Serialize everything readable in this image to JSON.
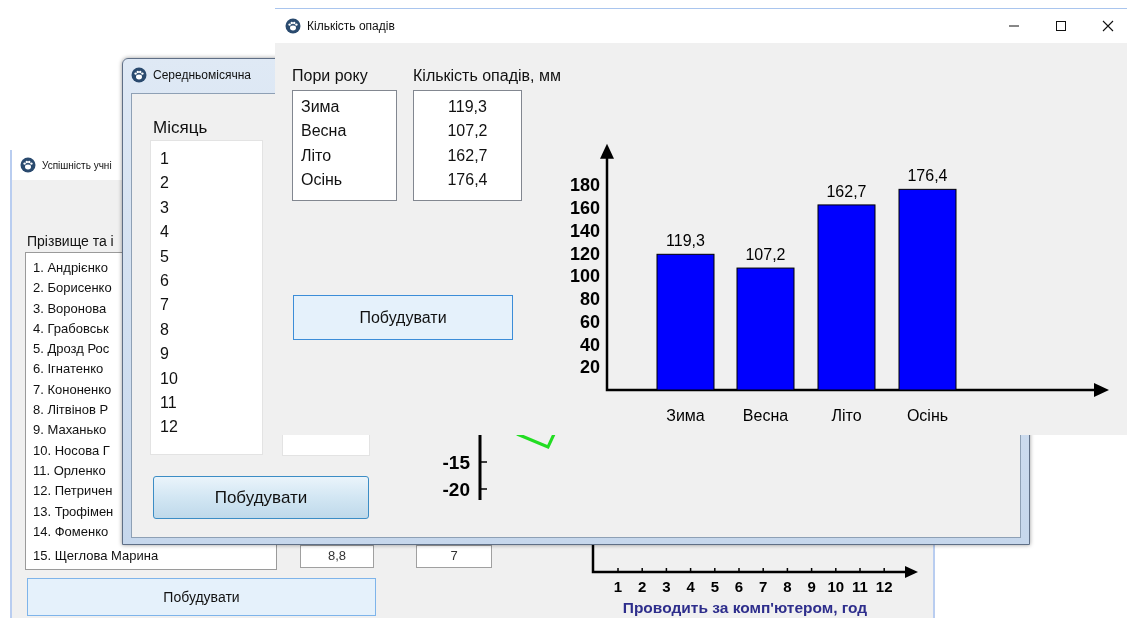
{
  "back_window": {
    "title": "Успішність учні",
    "list_label": "Прізвище та і",
    "students": [
      "1. Андрієнко",
      "2. Борисенко",
      "3. Воронова",
      "4. Грабовськ",
      "5. Дрозд Рос",
      "6. Ігнатенко",
      "7. Кононенко",
      "8. Літвінов Р",
      "9. Маханько",
      "10. Носова Г",
      "11. Орленко",
      "12. Петричен",
      "13. Трофімен",
      "14. Фоменко",
      "15. Щеглова Марина"
    ],
    "fields": [
      "8,8",
      "7"
    ],
    "button": "Побудувати",
    "chart_fragment": {
      "x_tick_labels": [
        "1",
        "2",
        "3",
        "4",
        "5",
        "6",
        "7",
        "8",
        "9",
        "10",
        "11",
        "12"
      ],
      "xlabel": "Проводить за комп'ютером, год"
    }
  },
  "middle_window": {
    "title": "Середньомісячна",
    "list_label": "Місяць",
    "months": [
      "1",
      "2",
      "3",
      "4",
      "5",
      "6",
      "7",
      "8",
      "9",
      "10",
      "11",
      "12"
    ],
    "button": "Побудувати",
    "chart_fragment": {
      "y_tick_labels": [
        "-15",
        "-20"
      ]
    }
  },
  "front_window": {
    "title": "Кількість опадів",
    "seasons_label": "Пори року",
    "amounts_label": "Кількість опадів, мм",
    "seasons": [
      "Зима",
      "Весна",
      "Літо",
      "Осінь"
    ],
    "amounts": [
      "119,3",
      "107,2",
      "162,7",
      "176,4"
    ],
    "button": "Побудувати",
    "chart_data": {
      "type": "bar",
      "categories": [
        "Зима",
        "Весна",
        "Літо",
        "Осінь"
      ],
      "series": [
        {
          "color": "#0000ff",
          "values": [
            119.3,
            107.2,
            162.7,
            176.4
          ]
        }
      ],
      "ylim": [
        0,
        206
      ],
      "yticks": [
        20,
        40,
        60,
        80,
        100,
        120,
        140,
        160,
        180
      ],
      "value_labels": [
        "119,3",
        "107,2",
        "162,7",
        "176,4"
      ]
    }
  }
}
